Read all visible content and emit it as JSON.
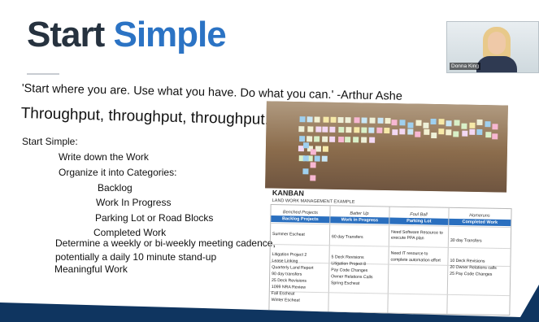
{
  "slide": {
    "title_part1": "Start",
    "title_part2": "Simple",
    "quote": "'Start where you are.  Use what you have.  Do what you can.' -Arthur Ashe",
    "subtitle": "Throughput, throughput, throughput....",
    "list": [
      "Start Simple:",
      "Write down the Work",
      "Organize it into Categories:",
      "Backlog",
      "Work In Progress",
      "Parking Lot or Road Blocks",
      "Completed Work",
      "Determine a weekly or bi-weekly meeting cadence,",
      "potentially a daily 10 minute stand-up",
      "Meaningful Work"
    ]
  },
  "video": {
    "participant_name": "Donna King"
  },
  "kanban": {
    "title": "KANBAN",
    "subtitle": "LAND WORK MANAGEMENT EXAMPLE",
    "captions": [
      "Benched Projects",
      "Batter Up",
      "Foul Ball",
      "Homeruns"
    ],
    "headers": [
      "Backlog Projects",
      "Work in Progress",
      "Parking Lot",
      "Completed Work"
    ],
    "backlog": [
      "Summer Escheat",
      "Litigation Project 2",
      "Lease Linking",
      "Quarterly Land Report",
      "90 day transfers",
      "25 Deck Revisions",
      "1099 NRA Review",
      "Fall Escheat",
      "Winter Escheat"
    ],
    "wip": [
      "60 day Transfers",
      "5 Deck Revisions",
      "Litigation Project 8",
      "Pay Code Changes",
      "Owner Relations Calls",
      "Spring Escheat"
    ],
    "parking": [
      "Need Software Resource to",
      "execute PPA plan",
      "Need IT resource to",
      "complete automation effort"
    ],
    "completed": [
      "30 day Transfers",
      "10 Deck Revisions",
      "20 Owner Relations calls",
      "25 Pay Code Changes"
    ]
  },
  "colors": {
    "background": "#0f3560",
    "title_dark": "#26323f",
    "title_blue": "#2b73c4",
    "table_header": "#2a6fbf"
  }
}
